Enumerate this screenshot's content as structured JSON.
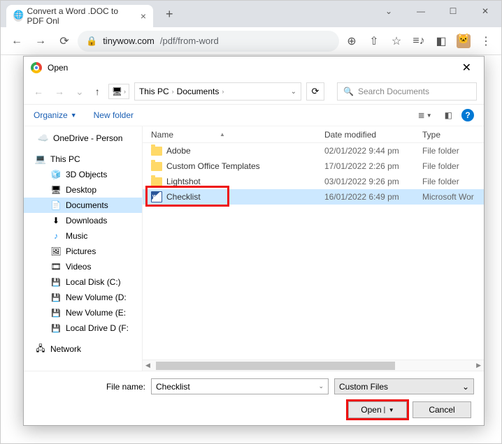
{
  "browser": {
    "tab_title": "Convert a Word .DOC to PDF Onl",
    "url_host": "tinywow.com",
    "url_path": "/pdf/from-word"
  },
  "dialog": {
    "title": "Open",
    "crumbs": {
      "root": "This PC",
      "folder": "Documents"
    },
    "search_placeholder": "Search Documents",
    "organize": "Organize",
    "new_folder": "New folder",
    "columns": {
      "name": "Name",
      "date": "Date modified",
      "type": "Type"
    },
    "sidebar": {
      "onedrive": "OneDrive - Person",
      "thispc": "This PC",
      "items": [
        "3D Objects",
        "Desktop",
        "Documents",
        "Downloads",
        "Music",
        "Pictures",
        "Videos",
        "Local Disk (C:)",
        "New Volume (D:",
        "New Volume (E:",
        "Local Drive D (F:"
      ],
      "network": "Network"
    },
    "files": [
      {
        "name": "Adobe",
        "date": "02/01/2022 9:44 pm",
        "type": "File folder",
        "kind": "folder"
      },
      {
        "name": "Custom Office Templates",
        "date": "17/01/2022 2:26 pm",
        "type": "File folder",
        "kind": "folder"
      },
      {
        "name": "Lightshot",
        "date": "03/01/2022 9:26 pm",
        "type": "File folder",
        "kind": "folder"
      },
      {
        "name": "Checklist",
        "date": "16/01/2022 6:49 pm",
        "type": "Microsoft Wor",
        "kind": "word"
      }
    ],
    "filename_label": "File name:",
    "filename_value": "Checklist",
    "type_filter": "Custom Files",
    "open_btn": "Open",
    "cancel_btn": "Cancel"
  }
}
